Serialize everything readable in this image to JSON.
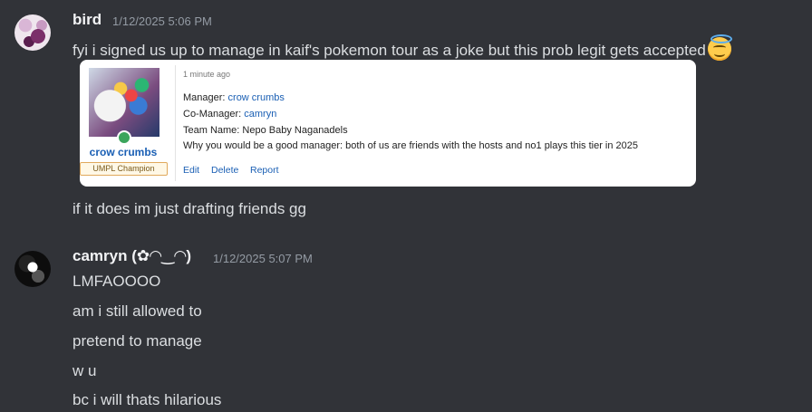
{
  "messages": [
    {
      "username": "bird",
      "timestamp": "1/12/2025 5:06 PM",
      "lines": [
        "fyi i signed us up to manage in kaif's pokemon tour as a joke but this prob legit gets accepted",
        "if it does im just drafting friends gg"
      ],
      "emoji": "innocent-face-emoji"
    },
    {
      "username": "camryn (✿◠‿◠)",
      "timestamp": "1/12/2025 5:07 PM",
      "lines": [
        "LMFAOOOO",
        "am i still allowed to",
        "pretend to manage",
        "w u",
        "bc i will thats hilarious"
      ]
    }
  ],
  "embed": {
    "profile_name": "crow crumbs",
    "badge": "UMPL Champion",
    "time_ago": "1 minute ago",
    "manager_label": "Manager: ",
    "manager_value": "crow crumbs",
    "comanager_label": "Co-Manager: ",
    "comanager_value": "camryn",
    "team_line": "Team Name: Nepo Baby Naganadels",
    "why_line": "Why you would be a good manager: both of us are friends with the hosts and no1 plays this tier in 2025",
    "actions": [
      "Edit",
      "Delete",
      "Report"
    ]
  },
  "colors": {
    "background": "#313338",
    "link": "#1a5fb4",
    "online": "#3ba55c"
  }
}
